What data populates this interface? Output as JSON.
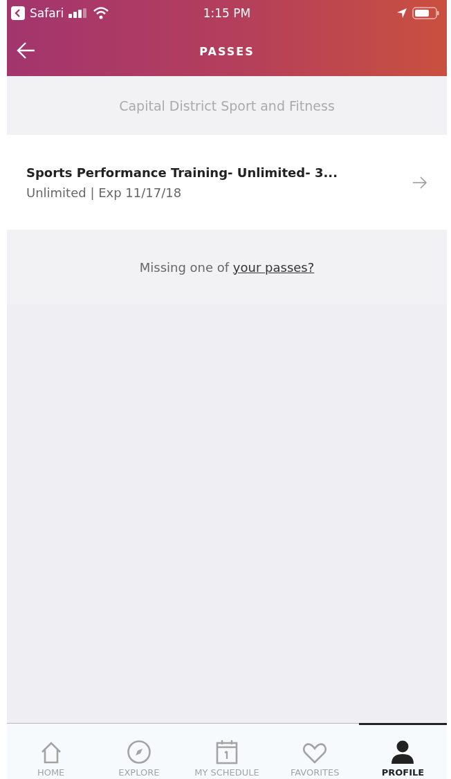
{
  "status_bar": {
    "back_app": "Safari",
    "time": "1:15 PM"
  },
  "nav": {
    "title": "PASSES"
  },
  "section": {
    "title": "Capital District Sport and Fitness"
  },
  "passes": [
    {
      "name": "Sports Performance Training- Unlimited- 3...",
      "detail": "Unlimited | Exp 11/17/18"
    }
  ],
  "missing": {
    "text": "Missing one of ",
    "link": "your passes?"
  },
  "tabs": [
    {
      "label": "HOME",
      "kind": "home",
      "selected": false
    },
    {
      "label": "EXPLORE",
      "kind": "explore",
      "selected": false
    },
    {
      "label": "MY SCHEDULE",
      "kind": "schedule",
      "selected": false
    },
    {
      "label": "FAVORITES",
      "kind": "favorites",
      "selected": false
    },
    {
      "label": "PROFILE",
      "kind": "profile",
      "selected": true
    }
  ]
}
